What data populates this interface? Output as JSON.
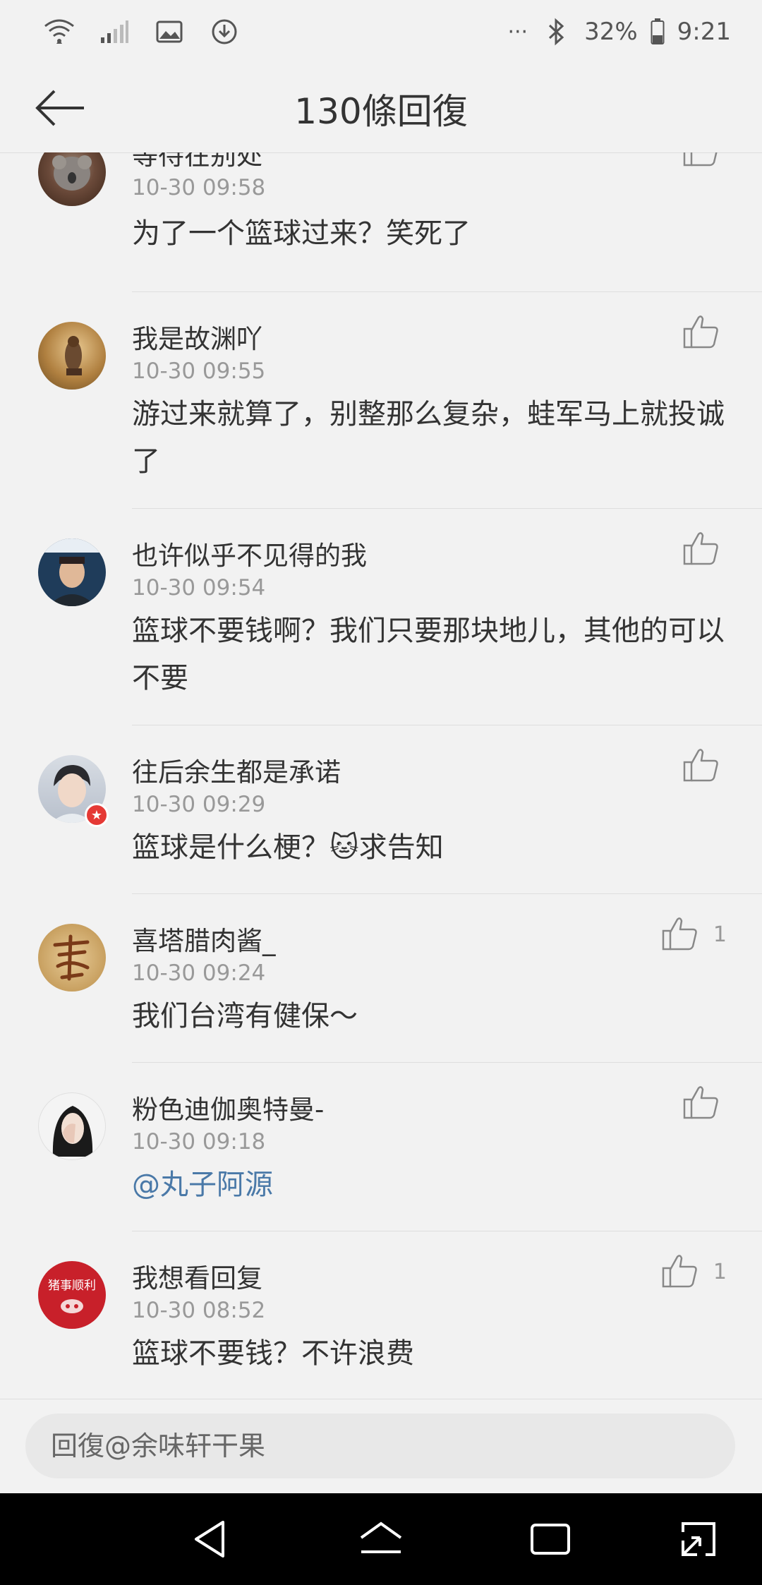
{
  "status_bar": {
    "battery": "32%",
    "time": "9:21",
    "dots": "···"
  },
  "header": {
    "title": "130條回復"
  },
  "comments": [
    {
      "user": "等待在别处",
      "time": "10-30 09:58",
      "text": "为了一个篮球过来？笑死了",
      "likes": ""
    },
    {
      "user": "我是故渊吖",
      "time": "10-30 09:55",
      "text": "游过来就算了，别整那么复杂，蛙军马上就投诚了",
      "likes": ""
    },
    {
      "user": "也许似乎不见得的我",
      "time": "10-30 09:54",
      "text": "篮球不要钱啊？我们只要那块地儿，其他的可以不要",
      "likes": ""
    },
    {
      "user": "往后余生都是承诺",
      "time": "10-30 09:29",
      "text_before": "篮球是什么梗？",
      "emoji": "🐱",
      "text_after": "求告知",
      "likes": ""
    },
    {
      "user": "喜塔腊肉酱_",
      "time": "10-30 09:24",
      "text": "我们台湾有健保～",
      "likes": "1"
    },
    {
      "user": "粉色迪伽奥特曼-",
      "time": "10-30 09:18",
      "text": "@丸子阿源",
      "likes": ""
    },
    {
      "user": "我想看回复",
      "time": "10-30 08:52",
      "text": "篮球不要钱？不许浪费",
      "likes": "1",
      "avatar_text": "猪事顺利"
    }
  ],
  "reply": {
    "placeholder": "回復@余味轩干果"
  },
  "icons": {
    "status": [
      "wifi-icon",
      "signal-icon",
      "image-icon",
      "download-icon",
      "bluetooth-icon",
      "battery-icon"
    ],
    "nav": [
      "back-triangle-icon",
      "home-icon",
      "recents-icon",
      "rotate-icon"
    ],
    "like": "thumbs-up-icon"
  }
}
